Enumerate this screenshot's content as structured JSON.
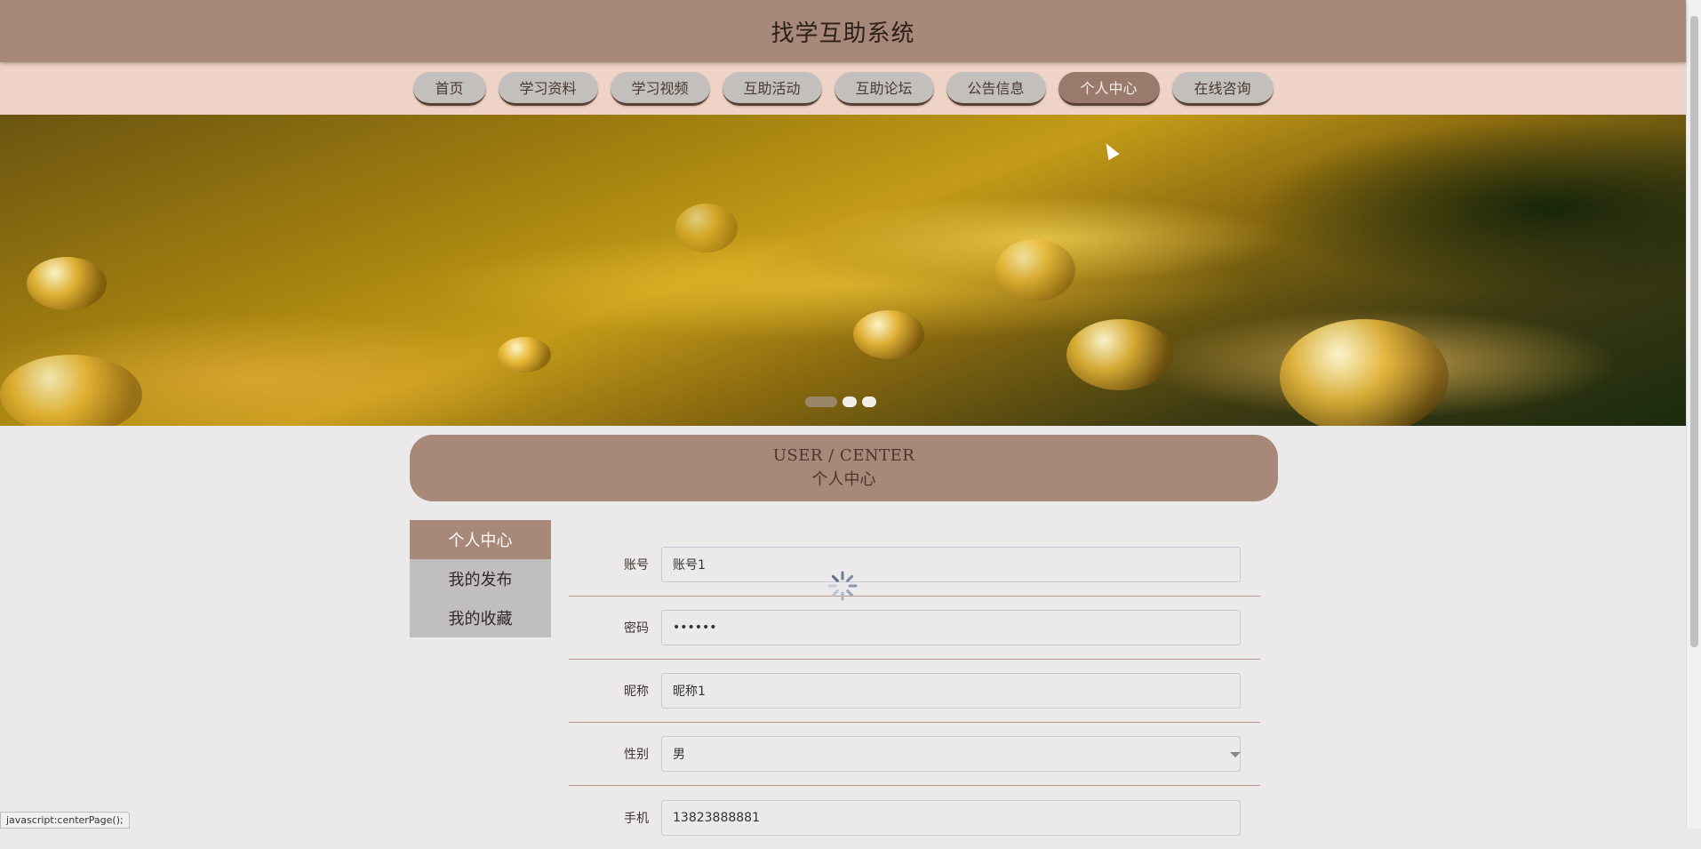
{
  "header": {
    "title": "找学互助系统"
  },
  "nav": {
    "items": [
      {
        "label": "首页"
      },
      {
        "label": "学习资料"
      },
      {
        "label": "学习视频"
      },
      {
        "label": "互助活动"
      },
      {
        "label": "互助论坛"
      },
      {
        "label": "公告信息"
      },
      {
        "label": "个人中心"
      },
      {
        "label": "在线咨询"
      }
    ],
    "active": "个人中心"
  },
  "section": {
    "en_title": "USER / CENTER",
    "zh_title": "个人中心"
  },
  "side_menu": {
    "items": [
      {
        "label": "个人中心"
      },
      {
        "label": "我的发布"
      },
      {
        "label": "我的收藏"
      }
    ],
    "active": "个人中心"
  },
  "form": {
    "account": {
      "label": "账号",
      "value": "账号1"
    },
    "password": {
      "label": "密码",
      "value": "••••••"
    },
    "nickname": {
      "label": "昵称",
      "value": "昵称1"
    },
    "gender": {
      "label": "性别",
      "value": "男"
    },
    "phone": {
      "label": "手机",
      "value": "13823888881"
    }
  },
  "status_bar": {
    "text": "javascript:centerPage();"
  },
  "colors": {
    "header_bg": "#a88878",
    "nav_bg": "#efd3c6",
    "nav_button_bg": "#c3bfbd",
    "nav_active_bg": "#9a7a6c",
    "page_bg": "#ebe9e9",
    "side_active_bg": "#a88878",
    "side_bg": "#c1bfbe"
  }
}
